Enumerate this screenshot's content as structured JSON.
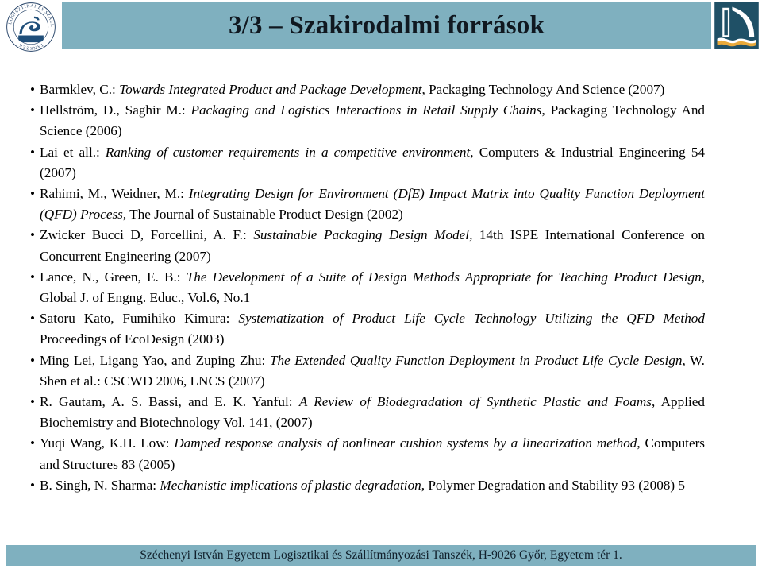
{
  "header": {
    "title": "3/3 – Szakirodalmi források",
    "bar_color": "#7fb0bf",
    "title_color": "#101820",
    "left_logo": {
      "icon": "department-seal-logo",
      "ring_text": "LOGISZTIKAI ÉS SZÁLLÍTMÁNYOZÁSI TANSZÉK",
      "color": "#1f4e79"
    },
    "right_logo": {
      "icon": "university-sail-logo",
      "colors": {
        "navy": "#1f4e63",
        "gold": "#e8a93a",
        "white": "#ffffff"
      }
    }
  },
  "references": [
    {
      "bullet": "•",
      "parts": [
        {
          "text": "Barmklev, C.: ",
          "italic": false
        },
        {
          "text": "Towards Integrated Product and Package Development",
          "italic": true
        },
        {
          "text": ", Packaging Technology And Science (2007)",
          "italic": false
        }
      ]
    },
    {
      "bullet": "•",
      "parts": [
        {
          "text": "Hellström, D., Saghir M.: ",
          "italic": false
        },
        {
          "text": "Packaging and Logistics Interactions in Retail Supply Chains",
          "italic": true
        },
        {
          "text": ", Packaging Technology And Science (2006)",
          "italic": false
        }
      ]
    },
    {
      "bullet": "•",
      "parts": [
        {
          "text": "Lai et all.: ",
          "italic": false
        },
        {
          "text": "Ranking of customer requirements in a competitive environment",
          "italic": true
        },
        {
          "text": ", Computers & Industrial Engineering 54 (2007)",
          "italic": false
        }
      ]
    },
    {
      "bullet": "•",
      "parts": [
        {
          "text": "Rahimi, M., Weidner, M.: ",
          "italic": false
        },
        {
          "text": "Integrating Design for Environment (DfE) Impact Matrix into Quality Function Deployment (QFD) Process",
          "italic": true
        },
        {
          "text": ", The Journal of Sustainable Product Design (2002)",
          "italic": false
        }
      ]
    },
    {
      "bullet": "•",
      "parts": [
        {
          "text": "Zwicker Bucci D, Forcellini, A. F.: ",
          "italic": false
        },
        {
          "text": "Sustainable Packaging Design Model",
          "italic": true
        },
        {
          "text": ", 14th ISPE International Conference on Concurrent Engineering (2007)",
          "italic": false
        }
      ]
    },
    {
      "bullet": "•",
      "parts": [
        {
          "text": "Lance, N., Green, E. B.: ",
          "italic": false
        },
        {
          "text": "The Development of a Suite of Design Methods Appropriate for Teaching Product Design",
          "italic": true
        },
        {
          "text": ", Global J. of Engng. Educ., Vol.6, No.1",
          "italic": false
        }
      ]
    },
    {
      "bullet": "•",
      "parts": [
        {
          "text": "Satoru Kato, Fumihiko Kimura: ",
          "italic": false
        },
        {
          "text": "Systematization of Product Life Cycle Technology Utilizing the QFD Method",
          "italic": true
        },
        {
          "text": " Proceedings of EcoDesign (2003)",
          "italic": false
        }
      ]
    },
    {
      "bullet": "•",
      "parts": [
        {
          "text": "Ming Lei, Ligang Yao, and Zuping Zhu: ",
          "italic": false
        },
        {
          "text": "The Extended Quality Function Deployment in Product Life Cycle Design",
          "italic": true
        },
        {
          "text": ", W. Shen et al.: CSCWD 2006, LNCS (2007)",
          "italic": false
        }
      ]
    },
    {
      "bullet": "•",
      "parts": [
        {
          "text": "R. Gautam, A. S. Bassi, and E. K. Yanful: ",
          "italic": false
        },
        {
          "text": "A Review of Biodegradation of Synthetic Plastic and Foams",
          "italic": true
        },
        {
          "text": ", Applied Biochemistry and Biotechnology Vol. 141, (2007)",
          "italic": false
        }
      ]
    },
    {
      "bullet": "•",
      "parts": [
        {
          "text": "Yuqi Wang, K.H. Low: ",
          "italic": false
        },
        {
          "text": "Damped response analysis of nonlinear cushion systems by a linearization method",
          "italic": true
        },
        {
          "text": ", Computers and Structures 83 (2005)",
          "italic": false
        }
      ]
    },
    {
      "bullet": "•",
      "parts": [
        {
          "text": "B. Singh, N. Sharma: ",
          "italic": false
        },
        {
          "text": "Mechanistic implications of plastic degradation",
          "italic": true
        },
        {
          "text": ", Polymer Degradation and Stability 93 (2008) 5",
          "italic": false
        }
      ]
    }
  ],
  "footer": {
    "text": "Széchenyi István Egyetem Logisztikai és Szállítmányozási Tanszék, H-9026 Győr, Egyetem tér 1.",
    "bar_color": "#7fb0bf",
    "text_color": "#11202c"
  }
}
